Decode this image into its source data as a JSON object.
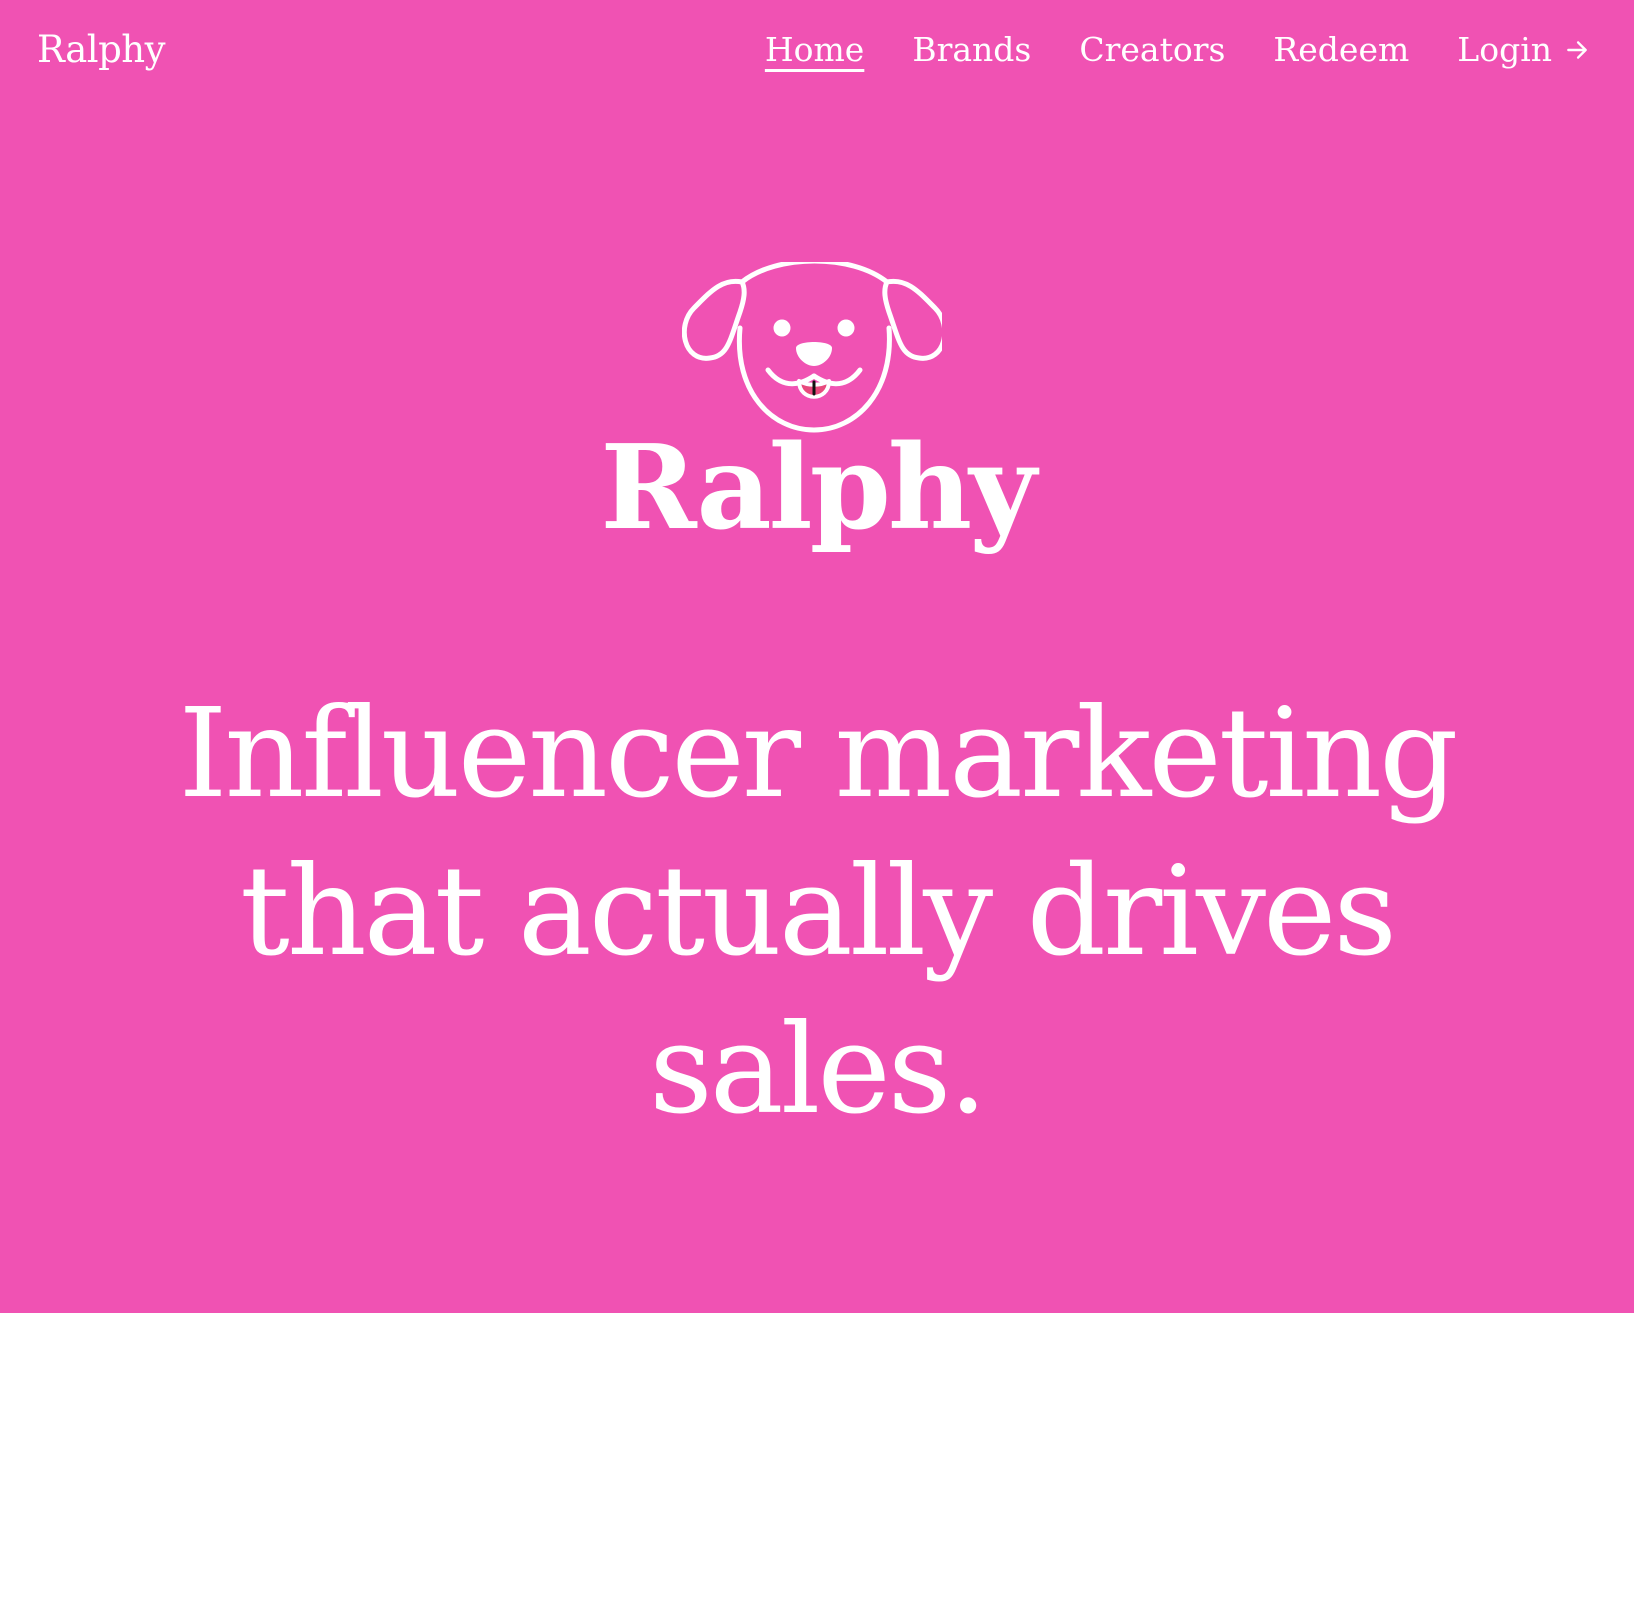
{
  "header": {
    "brand": "Ralphy",
    "nav": [
      {
        "label": "Home",
        "active": true
      },
      {
        "label": "Brands",
        "active": false
      },
      {
        "label": "Creators",
        "active": false
      },
      {
        "label": "Redeem",
        "active": false
      },
      {
        "label": "Login",
        "active": false,
        "icon": "arrow-right-icon"
      }
    ]
  },
  "hero": {
    "logo_icon": "dog-face-icon",
    "logo_text": "Ralphy",
    "headline": "Influencer marketing that actually drives sales."
  },
  "colors": {
    "hero_background": "#f052b3",
    "text": "#ffffff",
    "tongue": "#e84a7e",
    "page_background": "#ffffff"
  }
}
